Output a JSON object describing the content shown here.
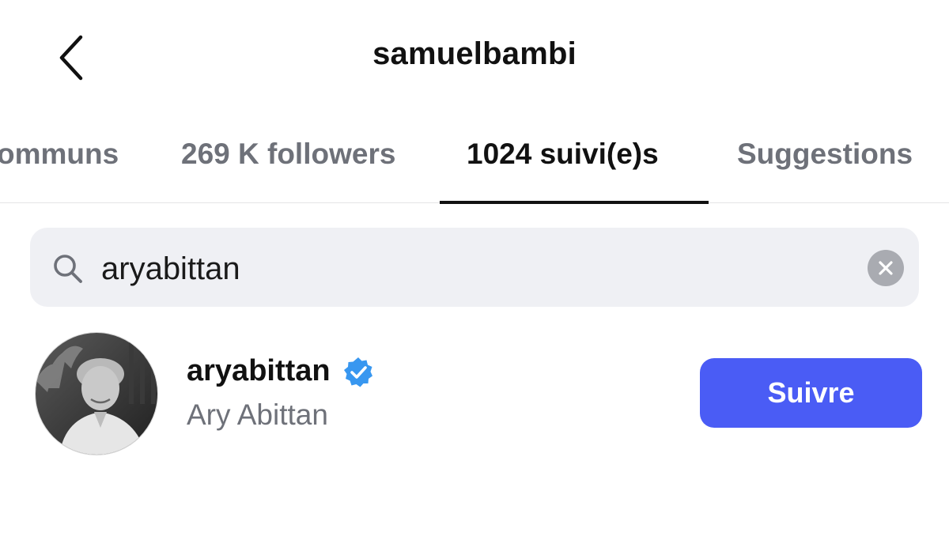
{
  "header": {
    "title": "samuelbambi",
    "back_icon": "chevron-left-icon"
  },
  "tabs": [
    {
      "label": "ommuns",
      "active": false
    },
    {
      "label": "269 K followers",
      "active": false
    },
    {
      "label": "1024 suivi(e)s",
      "active": true
    },
    {
      "label": "Suggestions",
      "active": false
    }
  ],
  "search": {
    "value": "aryabittan",
    "icon": "search-icon",
    "clear_icon": "clear-icon"
  },
  "result": {
    "username": "aryabittan",
    "verified": true,
    "full_name": "Ary Abittan",
    "follow_label": "Suivre",
    "avatar_icon": "avatar"
  },
  "colors": {
    "accent": "#4a5cf5",
    "verified": "#3897f0",
    "tab_inactive": "#6e7179",
    "search_bg": "#eff0f4"
  }
}
